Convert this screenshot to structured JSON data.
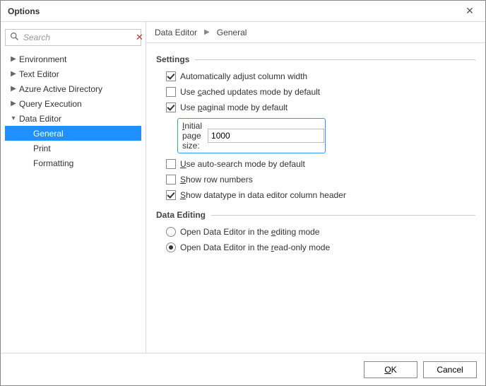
{
  "window": {
    "title": "Options"
  },
  "search": {
    "placeholder": "Search"
  },
  "tree": {
    "environment": "Environment",
    "text_editor": "Text Editor",
    "aad": "Azure Active Directory",
    "query_exec": "Query Execution",
    "data_editor": "Data Editor",
    "children": {
      "general": "General",
      "print": "Print",
      "formatting": "Formatting"
    }
  },
  "breadcrumb": {
    "a": "Data Editor",
    "b": "General"
  },
  "groups": {
    "settings": "Settings",
    "data_editing": "Data Editing"
  },
  "settings": {
    "auto_col_width": {
      "label": "Automatically adjust column width",
      "checked": true
    },
    "cached_updates": {
      "label_pre": "Use ",
      "label_u": "c",
      "label_post": "ached updates mode by default",
      "checked": false
    },
    "paginal": {
      "label_pre": "Use ",
      "label_u": "p",
      "label_post": "aginal mode by default",
      "checked": true
    },
    "page_size": {
      "label_u": "I",
      "label_post": "nitial page size:",
      "value": "1000"
    },
    "auto_search": {
      "label_u": "U",
      "label_post": "se auto-search mode by default",
      "checked": false
    },
    "row_numbers": {
      "label_u": "S",
      "label_post": "how row numbers",
      "checked": false
    },
    "show_datatype": {
      "label_u": "S",
      "label_post": "how datatype in data editor column header",
      "checked": true
    }
  },
  "editing": {
    "edit_mode": {
      "label_pre": "Open Data Editor in the ",
      "label_u": "e",
      "label_post": "diting mode"
    },
    "readonly_mode": {
      "label_pre": "Open Data Editor in the ",
      "label_u": "r",
      "label_post": "ead-only mode"
    },
    "selected": "readonly"
  },
  "buttons": {
    "ok_u": "O",
    "ok_post": "K",
    "cancel": "Cancel"
  }
}
